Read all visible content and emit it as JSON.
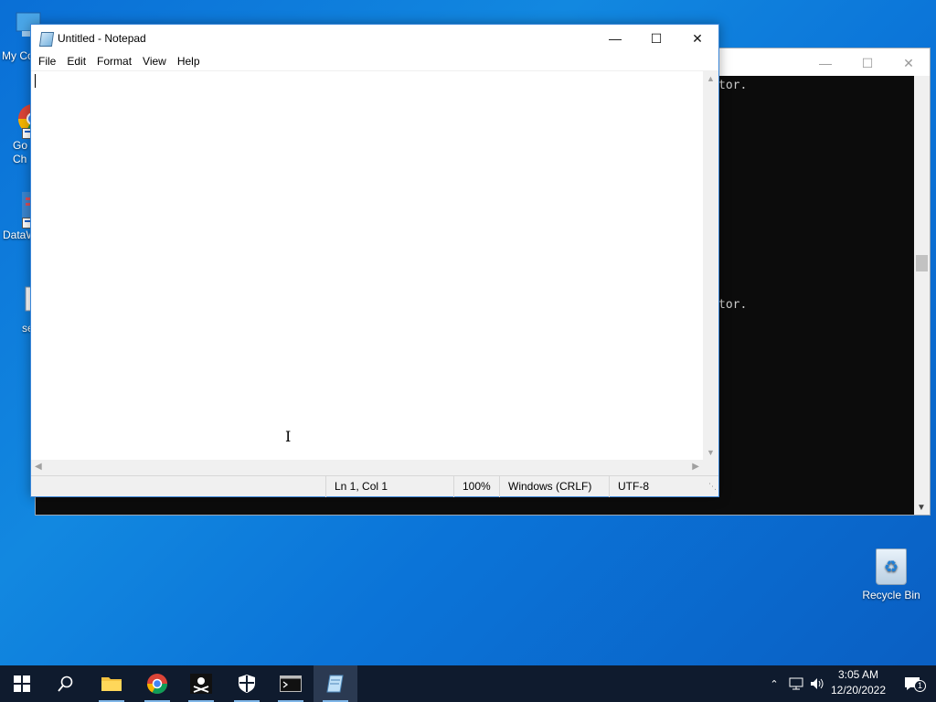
{
  "desktop": {
    "icons": [
      {
        "label": "My Co",
        "icon": "this-pc-icon"
      },
      {
        "label": "Go\nCh",
        "icon": "chrome-shortcut-icon"
      },
      {
        "label": "DataW",
        "icon": "datawrapper-shortcut-icon"
      },
      {
        "label": "se",
        "icon": "document-shortcut-icon"
      }
    ],
    "recycle_bin": {
      "label": "Recycle Bin",
      "icon": "recycle-bin-icon"
    }
  },
  "console": {
    "lines": [
      {
        "text": "tor."
      },
      {
        "text": "tor."
      }
    ],
    "controls": {
      "minimize": "—",
      "maximize": "☐",
      "close": "✕"
    }
  },
  "notepad": {
    "title": "Untitled - Notepad",
    "controls": {
      "minimize": "—",
      "maximize": "☐",
      "close": "✕"
    },
    "menu": [
      "File",
      "Edit",
      "Format",
      "View",
      "Help"
    ],
    "content": "",
    "status": {
      "position": "Ln 1, Col 1",
      "zoom": "100%",
      "line_endings": "Windows (CRLF)",
      "encoding": "UTF-8"
    }
  },
  "taskbar": {
    "apps": [
      {
        "name": "start",
        "icon": "windows-start-icon"
      },
      {
        "name": "search",
        "icon": "search-icon"
      },
      {
        "name": "file-explorer",
        "icon": "folder-icon"
      },
      {
        "name": "chrome",
        "icon": "chrome-icon"
      },
      {
        "name": "pirate",
        "icon": "pirate-flag-icon"
      },
      {
        "name": "security",
        "icon": "shield-icon"
      },
      {
        "name": "terminal",
        "icon": "terminal-icon"
      },
      {
        "name": "notepad",
        "icon": "notepad-icon"
      }
    ],
    "clock": {
      "time": "3:05 AM",
      "date": "12/20/2022"
    },
    "notification_count": "1"
  }
}
